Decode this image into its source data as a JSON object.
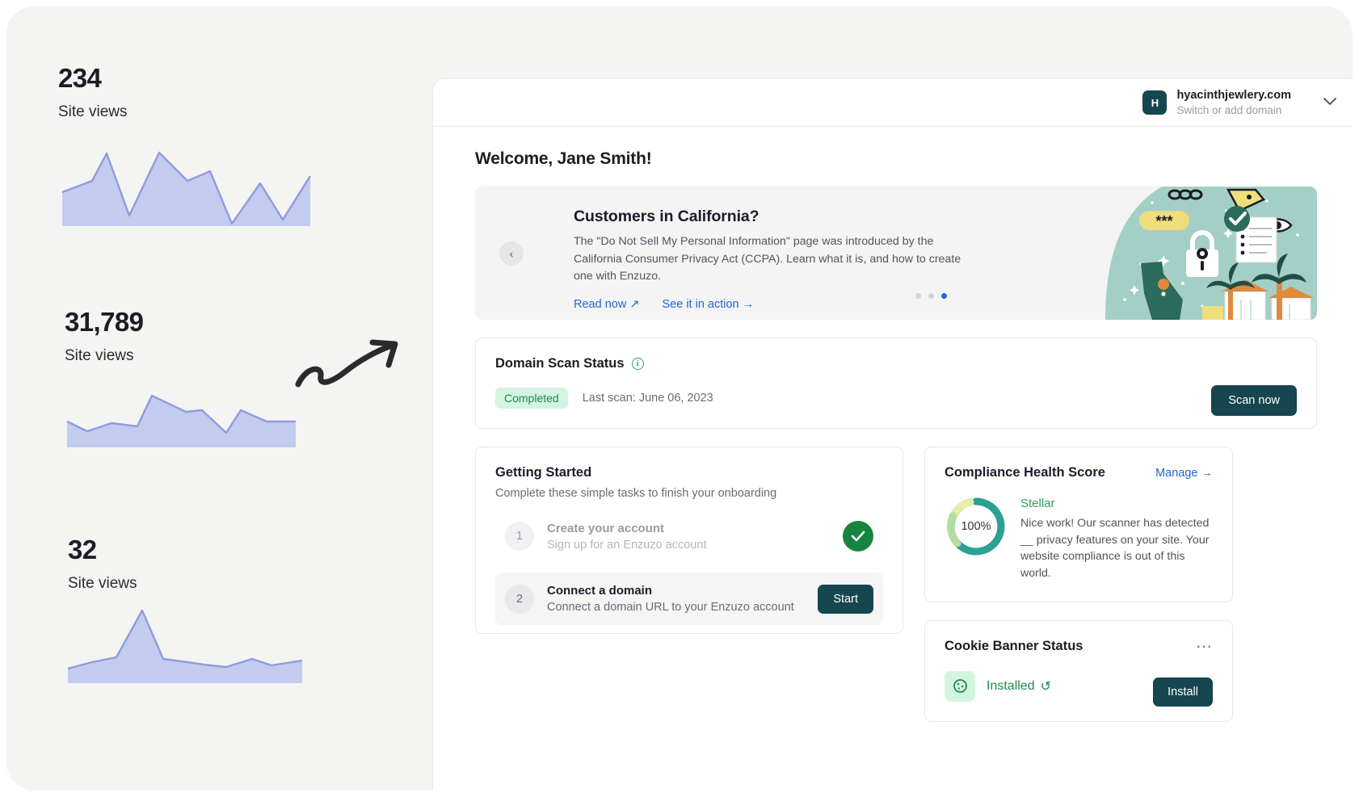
{
  "stats": [
    {
      "value": "234",
      "label": "Site views"
    },
    {
      "value": "31,789",
      "label": "Site views"
    },
    {
      "value": "32",
      "label": "Site views"
    }
  ],
  "topbar": {
    "avatar_initial": "H",
    "domain_name": "hyacinthjewlery.com",
    "domain_sub": "Switch or add domain",
    "chevron": "chevron-down-icon"
  },
  "welcome": "Welcome, Jane Smith!",
  "promo": {
    "prev_icon": "‹",
    "title": "Customers in California?",
    "description": "The \"Do Not Sell My Personal Information\" page was introduced by the California Consumer Privacy Act (CCPA). Learn what it is, and how to create one with Enzuzo.",
    "link_read": "Read now ↗",
    "link_action": "See it in action →",
    "dot_count": 3,
    "active_dot": 2
  },
  "scan": {
    "title": "Domain Scan Status",
    "info_icon": "info-icon",
    "badge": "Completed",
    "meta": "Last scan: June 06, 2023",
    "button": "Scan now"
  },
  "getting_started": {
    "title": "Getting Started",
    "subtitle": "Complete these simple tasks to finish your onboarding",
    "tasks": [
      {
        "num": "1",
        "name": "Create your account",
        "desc": "Sign up for an Enzuzo account",
        "state": "done",
        "action": ""
      },
      {
        "num": "2",
        "name": "Connect a domain",
        "desc": "Connect a domain URL to your Enzuzo account",
        "state": "active",
        "action": "Start"
      }
    ]
  },
  "compliance": {
    "title": "Compliance Health Score",
    "manage": "Manage →",
    "percent": "100%",
    "rating": "Stellar",
    "description": "Nice work! Our scanner has detected __ privacy features on your site. Your website compliance is out of this world."
  },
  "cookie": {
    "title": "Cookie Banner Status",
    "menu_icon": "ellipsis-icon",
    "state": "Installed",
    "refresh_icon": "↺",
    "button": "Install"
  },
  "colors": {
    "accent_dark": "#16464f",
    "link_blue": "#2266d6",
    "success_green": "#1f8a4c",
    "chart_fill": "#c3cbef",
    "chart_stroke": "#8e9ce0",
    "canvas_bg": "#f4f4f2"
  },
  "chart_data": [
    {
      "type": "area",
      "title": "Site views",
      "value_label": "234",
      "x": [
        0,
        1,
        2,
        3,
        4,
        5,
        6,
        7,
        8,
        9,
        10,
        11,
        12
      ],
      "values": [
        38,
        52,
        88,
        33,
        89,
        62,
        72,
        20,
        66,
        38,
        55,
        0,
        0
      ],
      "xlabel": "",
      "ylabel": "",
      "grid": false,
      "legend": "none"
    },
    {
      "type": "area",
      "title": "Site views",
      "value_label": "31,789",
      "x": [
        0,
        1,
        2,
        3,
        4,
        5,
        6,
        7,
        8,
        9,
        10
      ],
      "values": [
        30,
        18,
        26,
        22,
        72,
        50,
        52,
        22,
        50,
        40,
        36
      ],
      "xlabel": "",
      "ylabel": "",
      "grid": false,
      "legend": "none"
    },
    {
      "type": "area",
      "title": "Site views",
      "value_label": "32",
      "x": [
        0,
        1,
        2,
        3,
        4,
        5,
        6,
        7,
        8,
        9,
        10
      ],
      "values": [
        14,
        22,
        30,
        92,
        30,
        26,
        22,
        18,
        30,
        22,
        26
      ],
      "xlabel": "",
      "ylabel": "",
      "grid": false,
      "legend": "none"
    }
  ]
}
